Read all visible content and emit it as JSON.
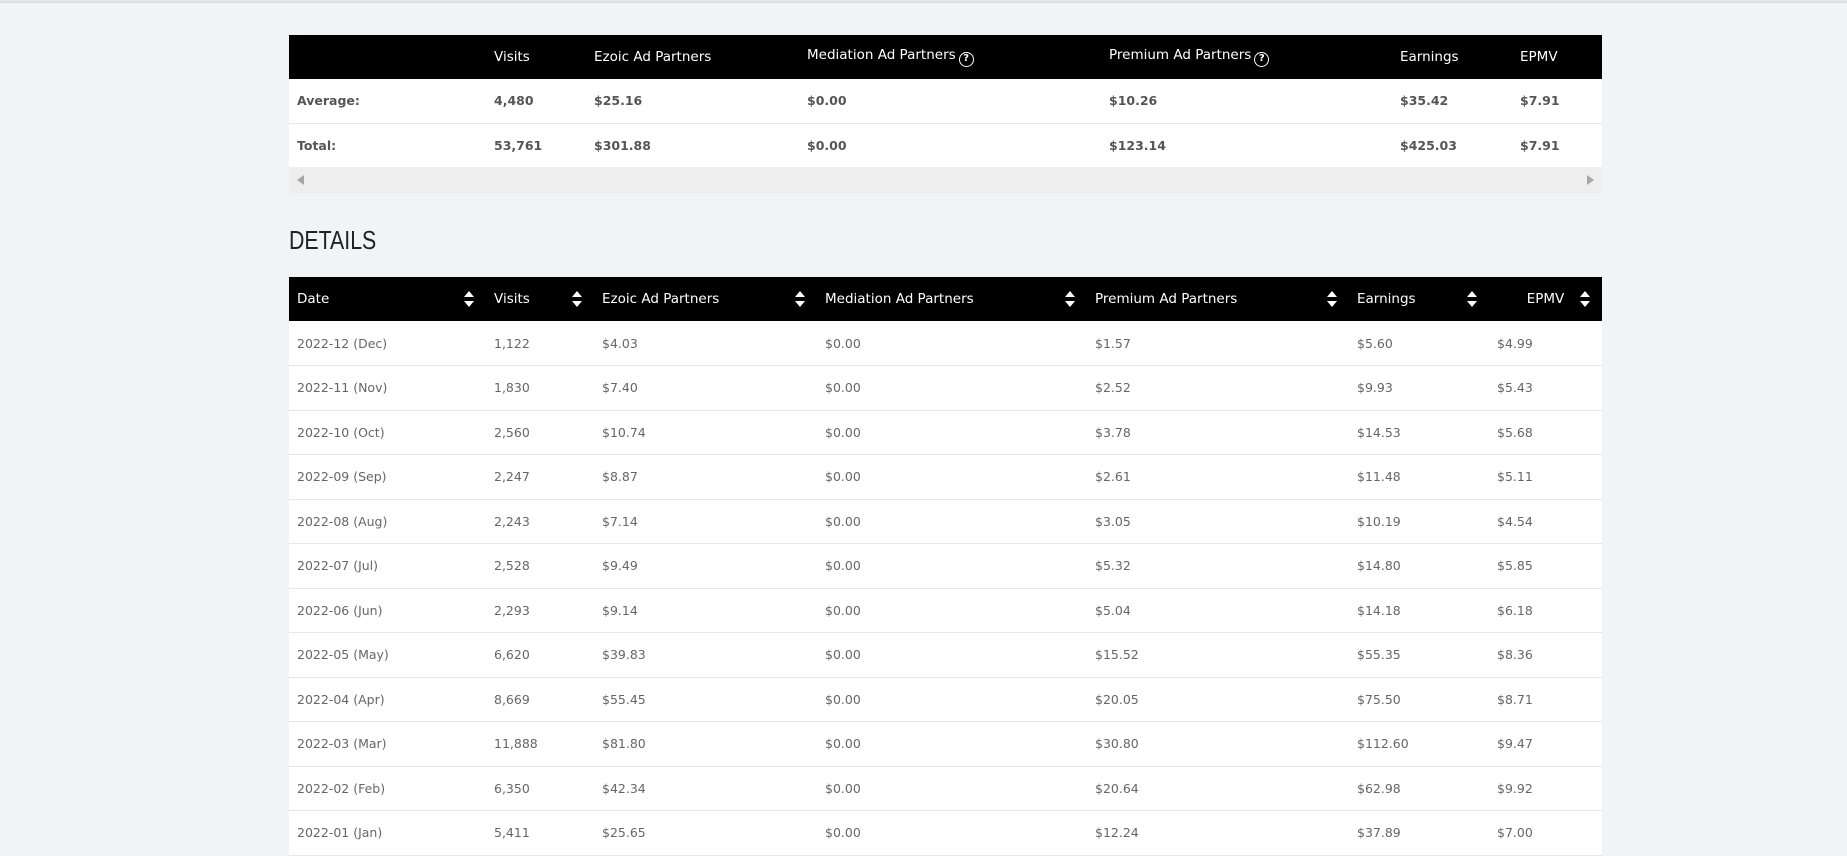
{
  "summary": {
    "headers": [
      "",
      "Visits",
      "Ezoic Ad Partners",
      "Mediation Ad Partners",
      "Premium Ad Partners",
      "Earnings",
      "EPMV"
    ],
    "help_icon_text": "?",
    "rows": [
      {
        "label": "Average:",
        "visits": "4,480",
        "ezoic": "$25.16",
        "mediation": "$0.00",
        "premium": "$10.26",
        "earnings": "$35.42",
        "epmv": "$7.91"
      },
      {
        "label": "Total:",
        "visits": "53,761",
        "ezoic": "$301.88",
        "mediation": "$0.00",
        "premium": "$123.14",
        "earnings": "$425.03",
        "epmv": "$7.91"
      }
    ]
  },
  "details": {
    "title": "DETAILS",
    "headers": [
      "Date",
      "Visits",
      "Ezoic Ad Partners",
      "Mediation Ad Partners",
      "Premium Ad Partners",
      "Earnings",
      "EPMV"
    ],
    "rows": [
      [
        "2022-12 (Dec)",
        "1,122",
        "$4.03",
        "$0.00",
        "$1.57",
        "$5.60",
        "$4.99"
      ],
      [
        "2022-11 (Nov)",
        "1,830",
        "$7.40",
        "$0.00",
        "$2.52",
        "$9.93",
        "$5.43"
      ],
      [
        "2022-10 (Oct)",
        "2,560",
        "$10.74",
        "$0.00",
        "$3.78",
        "$14.53",
        "$5.68"
      ],
      [
        "2022-09 (Sep)",
        "2,247",
        "$8.87",
        "$0.00",
        "$2.61",
        "$11.48",
        "$5.11"
      ],
      [
        "2022-08 (Aug)",
        "2,243",
        "$7.14",
        "$0.00",
        "$3.05",
        "$10.19",
        "$4.54"
      ],
      [
        "2022-07 (Jul)",
        "2,528",
        "$9.49",
        "$0.00",
        "$5.32",
        "$14.80",
        "$5.85"
      ],
      [
        "2022-06 (Jun)",
        "2,293",
        "$9.14",
        "$0.00",
        "$5.04",
        "$14.18",
        "$6.18"
      ],
      [
        "2022-05 (May)",
        "6,620",
        "$39.83",
        "$0.00",
        "$15.52",
        "$55.35",
        "$8.36"
      ],
      [
        "2022-04 (Apr)",
        "8,669",
        "$55.45",
        "$0.00",
        "$20.05",
        "$75.50",
        "$8.71"
      ],
      [
        "2022-03 (Mar)",
        "11,888",
        "$81.80",
        "$0.00",
        "$30.80",
        "$112.60",
        "$9.47"
      ],
      [
        "2022-02 (Feb)",
        "6,350",
        "$42.34",
        "$0.00",
        "$20.64",
        "$62.98",
        "$9.92"
      ],
      [
        "2022-01 (Jan)",
        "5,411",
        "$25.65",
        "$0.00",
        "$12.24",
        "$37.89",
        "$7.00"
      ]
    ]
  }
}
